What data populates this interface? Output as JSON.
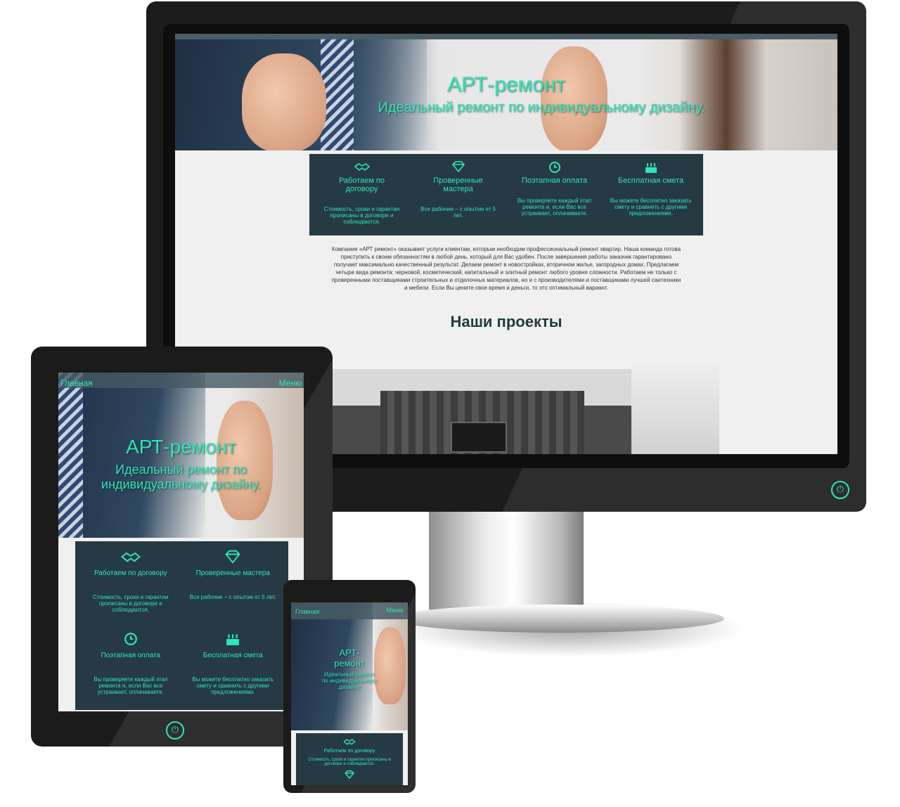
{
  "site": {
    "title": "АРТ-ремонт",
    "subtitle": "Идеальный ремонт по индивидуальному дизайну.",
    "nav": {
      "home": "Главная",
      "menu": "Меню"
    },
    "features": [
      {
        "icon": "handshake-icon",
        "title": "Работаем по договору",
        "desc": "Стоимость, сроки и гарантии прописаны в договоре и соблюдаются."
      },
      {
        "icon": "diamond-icon",
        "title": "Проверенные мастера",
        "desc": "Все рабочие – с опытом от 5 лет."
      },
      {
        "icon": "clock-icon",
        "title": "Поэтапная оплата",
        "desc": "Вы проверяете каждый этап ремонта и, если Вас все устраивает, оплачиваете."
      },
      {
        "icon": "cake-icon",
        "title": "Бесплатная смета",
        "desc": "Вы можете бесплатно заказать смету и сравнить с другими предложениями."
      }
    ],
    "about": "Компания «АРТ ремонт» оказывает услуги клиентам, которым необходим профессиональный ремонт квартир. Наша команда готова приступить к своим обязанностям в любой день, который для Вас удобен. После завершения работы заказчик гарантировано получает максимально качественный результат. Делаем ремонт в новостройках, вторичном жилье, загородных домах. Предлагаем четыре вида ремонта: черновой, косметический, капитальный и элитный ремонт любого уровня сложности. Работаем не только с проверенными поставщиками строительных и отделочных материалов, но и с производителями и поставщиками лучшей сантехники и мебели. Если Вы цените свое время и деньги, то это оптимальный вариант.",
    "projects_heading": "Наши проекты",
    "phone_title_line1": "АРТ-",
    "phone_title_line2": "ремонт",
    "tablet_subtitle_line1": "Идеальный ремонт по",
    "tablet_subtitle_line2": "индивидуальному дизайну.",
    "phone_subtitle": "Идеальный ремонт по индивидуальному дизайну"
  },
  "colors": {
    "accent": "#2ee6b8",
    "panel": "#263a44",
    "page_bg": "#f0f0f0",
    "device": "#1b1b1b"
  },
  "devices": [
    "desktop-monitor",
    "tablet",
    "phone"
  ]
}
